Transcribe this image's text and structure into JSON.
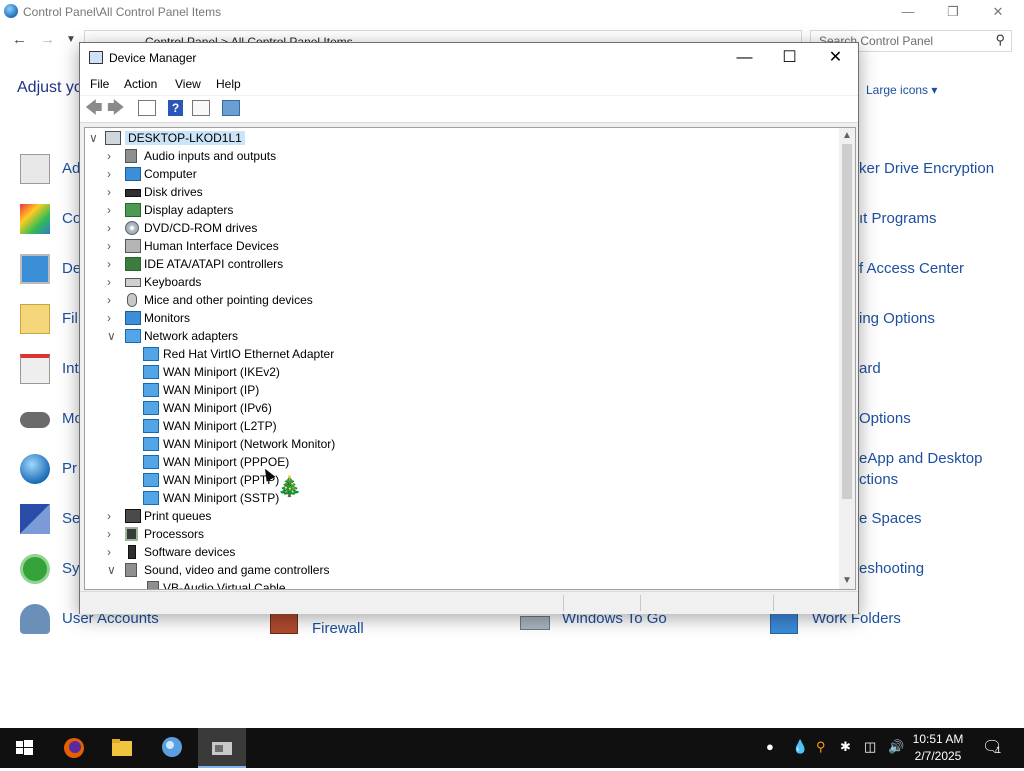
{
  "control_panel": {
    "title": "Control Panel\\All Control Panel Items",
    "breadcrumb": "Control Panel  >  All Control Panel Items",
    "search_placeholder": "Search Control Panel",
    "heading": "Adjust yo",
    "view_by": "Large icons",
    "left_items": [
      {
        "label": "Ad",
        "icon": "admin-tools-icon"
      },
      {
        "label": "Co",
        "icon": "color-management-icon"
      },
      {
        "label": "De",
        "icon": "devices-printers-icon"
      },
      {
        "label": "Fil",
        "icon": "file-explorer-icon"
      },
      {
        "label": "Int",
        "icon": "internet-options-icon"
      },
      {
        "label": "Mo",
        "icon": "mouse-icon"
      },
      {
        "label": "Pr",
        "icon": "programs-icon"
      },
      {
        "label": "Se",
        "icon": "security-icon"
      },
      {
        "label": "Sy",
        "icon": "sync-center-icon"
      }
    ],
    "right_items": [
      "ker Drive Encryption",
      "ıt Programs",
      "f Access Center",
      "ing Options",
      "ard",
      "Options",
      "eApp and Desktop",
      "ctions",
      "e Spaces",
      "eshooting"
    ],
    "bottom_items": [
      {
        "label": "User Accounts",
        "icon": "user-accounts-icon"
      },
      {
        "label": "Firewall",
        "icon": "firewall-icon"
      },
      {
        "label": "Windows To Go",
        "icon": "usb-drive-icon"
      },
      {
        "label": "Work Folders",
        "icon": "work-folders-icon"
      }
    ]
  },
  "device_manager": {
    "title": "Device Manager",
    "menu": [
      "File",
      "Action",
      "View",
      "Help"
    ],
    "root": "DESKTOP-LKOD1L1",
    "tree": [
      {
        "label": "Audio inputs and outputs",
        "expanded": false,
        "icon": "speaker-icon"
      },
      {
        "label": "Computer",
        "expanded": false,
        "icon": "computer-icon"
      },
      {
        "label": "Disk drives",
        "expanded": false,
        "icon": "disk-drive-icon"
      },
      {
        "label": "Display adapters",
        "expanded": false,
        "icon": "display-adapter-icon"
      },
      {
        "label": "DVD/CD-ROM drives",
        "expanded": false,
        "icon": "dvd-icon"
      },
      {
        "label": "Human Interface Devices",
        "expanded": false,
        "icon": "hid-icon"
      },
      {
        "label": "IDE ATA/ATAPI controllers",
        "expanded": false,
        "icon": "ide-controller-icon"
      },
      {
        "label": "Keyboards",
        "expanded": false,
        "icon": "keyboard-icon"
      },
      {
        "label": "Mice and other pointing devices",
        "expanded": false,
        "icon": "mouse-icon"
      },
      {
        "label": "Monitors",
        "expanded": false,
        "icon": "monitor-icon"
      },
      {
        "label": "Network adapters",
        "expanded": true,
        "icon": "network-adapter-icon",
        "children": [
          "Red Hat VirtIO Ethernet Adapter",
          "WAN Miniport (IKEv2)",
          "WAN Miniport (IP)",
          "WAN Miniport (IPv6)",
          "WAN Miniport (L2TP)",
          "WAN Miniport (Network Monitor)",
          "WAN Miniport (PPPOE)",
          "WAN Miniport (PPTP)",
          "WAN Miniport (SSTP)"
        ]
      },
      {
        "label": "Print queues",
        "expanded": false,
        "icon": "printer-icon"
      },
      {
        "label": "Processors",
        "expanded": false,
        "icon": "processor-icon"
      },
      {
        "label": "Software devices",
        "expanded": false,
        "icon": "software-device-icon"
      },
      {
        "label": "Sound, video and game controllers",
        "expanded": true,
        "icon": "sound-icon",
        "children": [
          "VB-Audio Virtual Cable"
        ]
      }
    ]
  },
  "taskbar": {
    "apps": [
      "start-icon",
      "firefox-icon",
      "file-explorer-icon",
      "control-panel-icon",
      "device-manager-icon"
    ],
    "time": "10:51 AM",
    "date": "2/7/2025",
    "notification_count": "1"
  }
}
